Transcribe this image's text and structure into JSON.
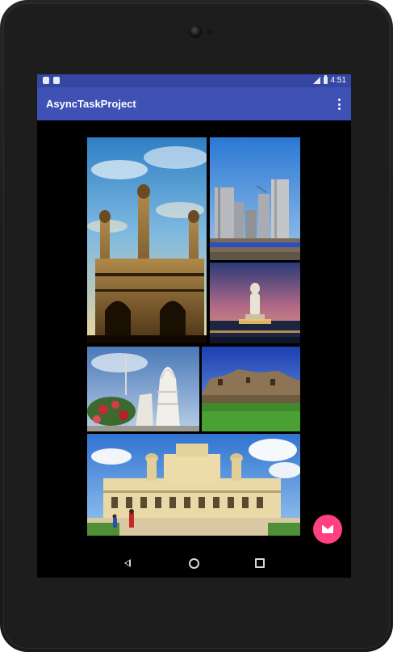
{
  "status_bar": {
    "time": "4:51",
    "icons": [
      "sim-card-icon",
      "android-icon",
      "signal-icon",
      "battery-icon"
    ]
  },
  "app_bar": {
    "title": "AsyncTaskProject",
    "overflow_icon": "more-vert-icon"
  },
  "gallery": {
    "photos": [
      {
        "name": "charminar-photo"
      },
      {
        "name": "skyscrapers-photo"
      },
      {
        "name": "buddha-statue-photo"
      },
      {
        "name": "birla-mandir-photo"
      },
      {
        "name": "golconda-fort-photo"
      },
      {
        "name": "chowmahalla-palace-photo"
      }
    ]
  },
  "fab": {
    "icon": "email-icon",
    "color": "#ff4081"
  },
  "nav_bar": {
    "icons": [
      "back-icon",
      "home-icon",
      "recents-icon"
    ]
  },
  "colors": {
    "primary": "#3f51b5",
    "primary_dark": "#3546a3",
    "accent": "#ff4081"
  }
}
